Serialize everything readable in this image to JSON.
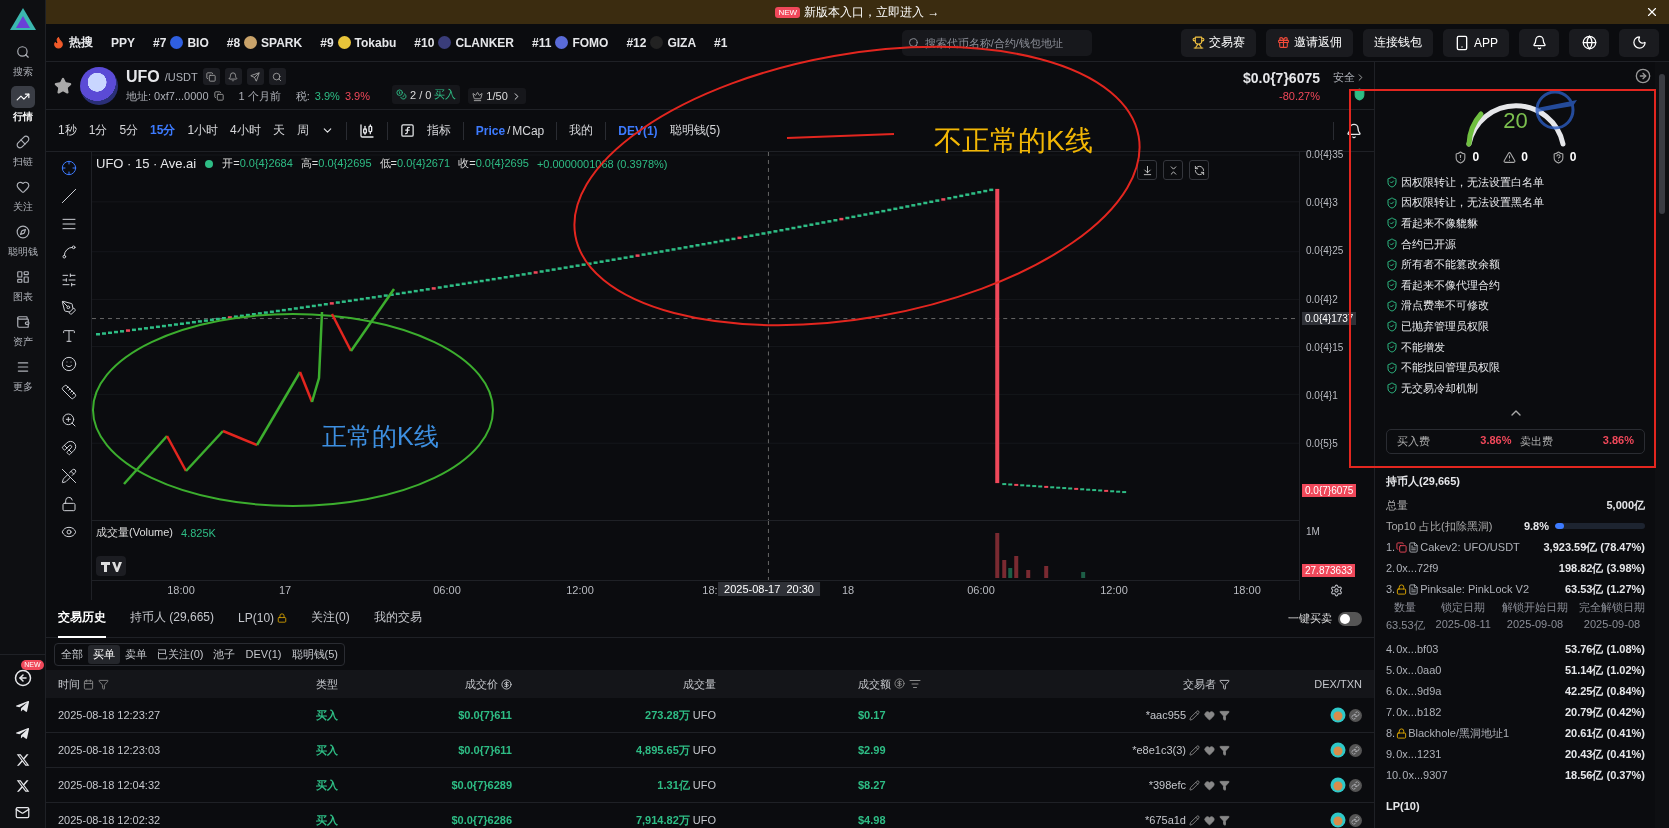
{
  "banner": {
    "badge": "NEW",
    "text": "新版本入口，立即进入",
    "arrow": "→"
  },
  "sidebar": {
    "items": [
      {
        "label": "搜索",
        "selected": false
      },
      {
        "label": "行情",
        "selected": true
      },
      {
        "label": "扫链",
        "selected": false
      },
      {
        "label": "关注",
        "selected": false
      },
      {
        "label": "聪明钱",
        "selected": false
      },
      {
        "label": "图表",
        "selected": false
      },
      {
        "label": "资产",
        "selected": false
      },
      {
        "label": "更多",
        "selected": false
      }
    ],
    "bottom_badge": "NEW"
  },
  "hot_bar": {
    "label": "热搜",
    "items": [
      {
        "name": "PPY"
      },
      {
        "rank": "#7",
        "name": "BIO"
      },
      {
        "rank": "#8",
        "name": "SPARK"
      },
      {
        "rank": "#9",
        "name": "Tokabu"
      },
      {
        "rank": "#10",
        "name": "CLANKER"
      },
      {
        "rank": "#11",
        "name": "FOMO"
      },
      {
        "rank": "#12",
        "name": "GIZA"
      },
      {
        "rank": "#1"
      }
    ]
  },
  "search": {
    "placeholder": "搜索代币名称/合约/钱包地址"
  },
  "top_buttons": [
    {
      "kind": "trophy",
      "label": "交易赛"
    },
    {
      "kind": "gift",
      "label": "邀请返佣"
    },
    {
      "kind": "plain",
      "label": "连接钱包"
    },
    {
      "kind": "phone",
      "label": "APP"
    },
    {
      "kind": "bell"
    },
    {
      "kind": "globe"
    },
    {
      "kind": "moon"
    }
  ],
  "token": {
    "symbol": "UFO",
    "quote": "/USDT",
    "address": "地址: 0xf7...0000",
    "age": "1 个月前",
    "tax_label": "税:",
    "tax_buy": "3.9%",
    "tax_sell": "3.9%",
    "buyers": "2 / 0",
    "buyers_label": "买入",
    "rank": "1/50",
    "price": "$0.0{7}6075",
    "change": "-80.27%",
    "safety": "安全"
  },
  "chart_toolbar": {
    "intervals": [
      {
        "label": "1秒",
        "selected": false
      },
      {
        "label": "1分",
        "selected": false
      },
      {
        "label": "5分",
        "selected": false
      },
      {
        "label": "15分",
        "selected": true
      },
      {
        "label": "1小时",
        "selected": false
      },
      {
        "label": "4小时",
        "selected": false
      },
      {
        "label": "天",
        "selected": false
      },
      {
        "label": "周",
        "selected": false
      }
    ],
    "indicator": "指标",
    "price_modes": [
      {
        "label": "Price",
        "selected": true
      },
      {
        "label": "MCap",
        "selected": false
      }
    ],
    "mode_separator": "/",
    "mine": "我的",
    "overlays": [
      {
        "label": "DEV(1)",
        "selected": true
      },
      {
        "label": "聪明钱(5)",
        "selected": false
      }
    ]
  },
  "chart": {
    "legend": {
      "title": "UFO · 15 · Ave.ai",
      "ohlc": [
        {
          "label": "开=",
          "value": "0.0{4}2684"
        },
        {
          "label": "高=",
          "value": "0.0{4}2695"
        },
        {
          "label": "低=",
          "value": "0.0{4}2671"
        },
        {
          "label": "收=",
          "value": "0.0{4}2695"
        }
      ],
      "change": "+0.0000001068 (0.3978%)"
    },
    "price_ticks": [
      "0.0{4}35",
      "0.0{4}3",
      "0.0{4}25",
      "0.0{4}2",
      "0.0{4}15",
      "0.0{4}1",
      "0.0{5}5"
    ],
    "crosshair_price": "0.0{4}1737",
    "last_price": "0.0{7}6075",
    "volume_label": "成交量(Volume)",
    "volume_value": "4.825K",
    "volume_tick": "1M",
    "last_volume": "27.873633",
    "time_ticks": [
      "18:00",
      "17",
      "06:00",
      "12:00",
      "18:",
      "18",
      "06:00",
      "12:00",
      "18:00"
    ],
    "crosshair_time": "2025-08-17  20:30"
  },
  "annotations": [
    {
      "text": "不正常的K线",
      "color": "#f2b705"
    },
    {
      "text": "正常的K线",
      "color": "#3d8fe0"
    }
  ],
  "security": {
    "score": "20",
    "risk_counts": [
      {
        "kind": "flash",
        "value": "0"
      },
      {
        "kind": "warning",
        "value": "0"
      },
      {
        "kind": "question",
        "value": "0"
      }
    ],
    "checks": [
      "因权限转让，无法设置白名单",
      "因权限转让，无法设置黑名单",
      "看起来不像貔貅",
      "合约已开源",
      "所有者不能篡改余额",
      "看起来不像代理合约",
      "滑点费率不可修改",
      "已抛弃管理员权限",
      "不能增发",
      "不能找回管理员权限",
      "无交易冷却机制"
    ],
    "fees": [
      {
        "label": "买入费",
        "value": "3.86%"
      },
      {
        "label": "卖出费",
        "value": "3.86%"
      }
    ]
  },
  "holders": {
    "title": "持币人(29,665)",
    "total_label": "总量",
    "total": "5,000亿",
    "top10": {
      "label": "Top10 占比(扣除黑洞)",
      "value": "9.8%",
      "level": 0.098
    },
    "rows": [
      {
        "rank": "1.",
        "badges": [
          {
            "kind": "pool"
          },
          {
            "kind": "doc"
          }
        ],
        "name": "Cakev2: UFO/USDT",
        "amount": "3,923.59亿 (78.47%)"
      },
      {
        "rank": "2.",
        "name": "0x...72f9",
        "amount": "198.82亿 (3.98%)"
      },
      {
        "rank": "3.",
        "badges": [
          {
            "kind": "lock"
          },
          {
            "kind": "doc"
          }
        ],
        "name": "Pinksale: PinkLock V2",
        "amount": "63.53亿 (1.27%)",
        "lock_detail": {
          "columns": [
            "数量",
            "锁定日期",
            "解锁开始日期",
            "完全解锁日期"
          ],
          "values": [
            "63.53亿",
            "2025-08-11",
            "2025-09-08",
            "2025-09-08"
          ]
        }
      },
      {
        "rank": "4.",
        "name": "0x...bf03",
        "amount": "53.76亿 (1.08%)"
      },
      {
        "rank": "5.",
        "name": "0x...0aa0",
        "amount": "51.14亿 (1.02%)"
      },
      {
        "rank": "6.",
        "name": "0x...9d9a",
        "amount": "42.25亿 (0.84%)"
      },
      {
        "rank": "7.",
        "name": "0x...b182",
        "amount": "20.79亿 (0.42%)"
      },
      {
        "rank": "8.",
        "badges": [
          {
            "kind": "lock"
          }
        ],
        "name": "Blackhole/黑洞地址1",
        "amount": "20.61亿 (0.41%)"
      },
      {
        "rank": "9.",
        "name": "0x...1231",
        "amount": "20.43亿 (0.41%)"
      },
      {
        "rank": "10.",
        "name": "0x...9307",
        "amount": "18.56亿 (0.37%)"
      }
    ],
    "lp_title": "LP(10)"
  },
  "bottom_tabs": [
    {
      "label": "交易历史",
      "selected": true,
      "locked": false
    },
    {
      "label": "持币人 (29,665)",
      "selected": false,
      "locked": false
    },
    {
      "label": "LP(10)",
      "selected": false,
      "locked": true
    },
    {
      "label": "关注(0)",
      "selected": false,
      "locked": false
    },
    {
      "label": "我的交易",
      "selected": false,
      "locked": false
    }
  ],
  "quick_trade": {
    "label": "一键买卖",
    "on": false
  },
  "filters": [
    {
      "label": "全部",
      "selected": false
    },
    {
      "label": "买单",
      "selected": true
    },
    {
      "label": "卖单",
      "selected": false
    },
    {
      "label": "已关注(0)",
      "selected": false
    },
    {
      "label": "池子",
      "selected": false
    },
    {
      "label": "DEV(1)",
      "selected": false
    },
    {
      "label": "聪明钱(5)",
      "selected": false
    }
  ],
  "trades": {
    "columns": [
      {
        "label": "时间",
        "kind": "time"
      },
      {
        "label": "类型",
        "kind": "type"
      },
      {
        "label": "成交价",
        "kind": "price"
      },
      {
        "label": "成交量",
        "kind": "volume"
      },
      {
        "label": "成交额",
        "kind": "value"
      },
      {
        "label": "交易者",
        "kind": "trader"
      },
      {
        "label": "DEX/TXN",
        "kind": "dex"
      }
    ],
    "rows": [
      {
        "time": "2025-08-18 12:23:27",
        "kind": "buy",
        "type": "买入",
        "price": "$0.0{7}611",
        "amount": "273.28万",
        "unit": "UFO",
        "value": "$0.17",
        "trader": "*aac955"
      },
      {
        "time": "2025-08-18 12:23:03",
        "kind": "buy",
        "type": "买入",
        "price": "$0.0{7}611",
        "amount": "4,895.65万",
        "unit": "UFO",
        "value": "$2.99",
        "trader": "*e8e1c3(3)"
      },
      {
        "time": "2025-08-18 12:04:32",
        "kind": "buy",
        "type": "买入",
        "price": "$0.0{7}6289",
        "amount": "1.31亿",
        "unit": "UFO",
        "value": "$8.27",
        "trader": "*398efc"
      },
      {
        "time": "2025-08-18 12:02:32",
        "kind": "buy",
        "type": "买入",
        "price": "$0.0{7}6286",
        "amount": "7,914.82万",
        "unit": "UFO",
        "value": "$4.98",
        "trader": "*675a1d"
      }
    ]
  }
}
